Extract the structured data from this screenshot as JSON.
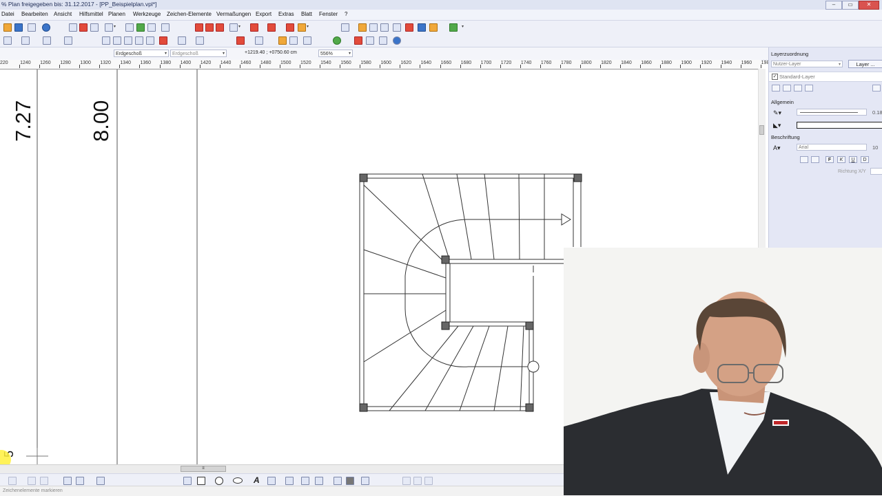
{
  "titlebar": {
    "title": "% Plan freigegeben bis: 31.12.2017 - [PP_Beispielplan.vpl*]",
    "minimize": "–",
    "restore": "▭",
    "close": "✕"
  },
  "menu": [
    "Datei",
    "Bearbeiten",
    "Ansicht",
    "Hilfsmittel",
    "Planen",
    "Werkzeuge",
    "Zeichen-Elemente",
    "Vermaßungen",
    "Export",
    "Extras",
    "Blatt",
    "Fenster",
    "?"
  ],
  "context": {
    "floor_select": "Erdgeschoß",
    "floor_select_2": "Erdgeschoß",
    "coordinates": "+1219.40 ; +0750.60 cm",
    "zoom": "556%"
  },
  "ruler": {
    "labels": [
      "220",
      "1240",
      "1260",
      "1280",
      "1300",
      "1320",
      "1340",
      "1360",
      "1380",
      "1400",
      "1420",
      "1440",
      "1460",
      "1480",
      "1500",
      "1520",
      "1540",
      "1560",
      "1580",
      "1600",
      "1620",
      "1640",
      "1660",
      "1680",
      "1700",
      "1720",
      "1740",
      "1760",
      "1780",
      "1800",
      "1820",
      "1840",
      "1860",
      "1880",
      "1900",
      "1920",
      "1940",
      "1960",
      "198"
    ]
  },
  "canvas": {
    "dim_text_1": "7.27",
    "dim_text_2": "8.00",
    "corner_text": "5"
  },
  "panel": {
    "heading": "Layerzuordnung",
    "user_layer": "Nutzer-Layer",
    "layer_button": "Layer ...",
    "standard_layer": "Standard-Layer",
    "section_general": "Allgemein",
    "line_width": "0.18",
    "section_label": "Beschriftung",
    "font": "Arial",
    "font_size": "10",
    "format_buttons": [
      "F",
      "K",
      "U",
      "D"
    ],
    "direction_label": "Richtung X/Y"
  },
  "status": {
    "text": "Zeichenelemente markieren"
  },
  "colors": {
    "panel_bg": "#e4e7f5",
    "toolbar_bg": "#eef0f8",
    "drawing_line": "#333333"
  }
}
